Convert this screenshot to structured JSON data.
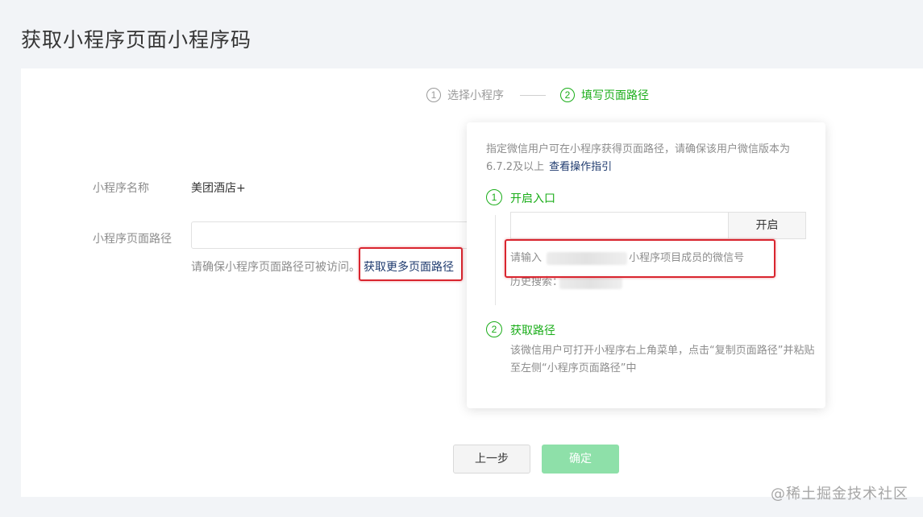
{
  "page": {
    "title": "获取小程序页面小程序码"
  },
  "stepper": {
    "steps": [
      {
        "number": "1",
        "label": "选择小程序",
        "active": false
      },
      {
        "number": "2",
        "label": "填写页面路径",
        "active": true
      }
    ]
  },
  "form": {
    "name_label": "小程序名称",
    "name_value": "美团酒店+",
    "path_label": "小程序页面路径",
    "path_input_value": "",
    "hint": "请确保小程序页面路径可被访问。",
    "more_path_link": "获取更多页面路径"
  },
  "popover": {
    "intro": "指定微信用户可在小程序获得页面路径，请确保该用户微信版本为6.7.2及以上",
    "guide_link": "查看操作指引",
    "step1": {
      "number": "1",
      "title": "开启入口",
      "input_value": "",
      "button_label": "开启",
      "instruction_prefix": "请输入",
      "instruction_suffix": "小程序项目成员的微信号",
      "history_label": "历史搜索："
    },
    "step2": {
      "number": "2",
      "title": "获取路径",
      "desc": "该微信用户可打开小程序右上角菜单，点击“复制页面路径”并粘贴至左侧“小程序页面路径”中"
    }
  },
  "actions": {
    "prev_label": "上一步",
    "confirm_label": "确定"
  },
  "watermark": "@稀土掘金技术社区",
  "colors": {
    "accent_green": "#1aad19",
    "link_blue": "#1e3a6e",
    "confirm_disabled": "#8ee0a9",
    "highlight_red": "#d9252f"
  }
}
